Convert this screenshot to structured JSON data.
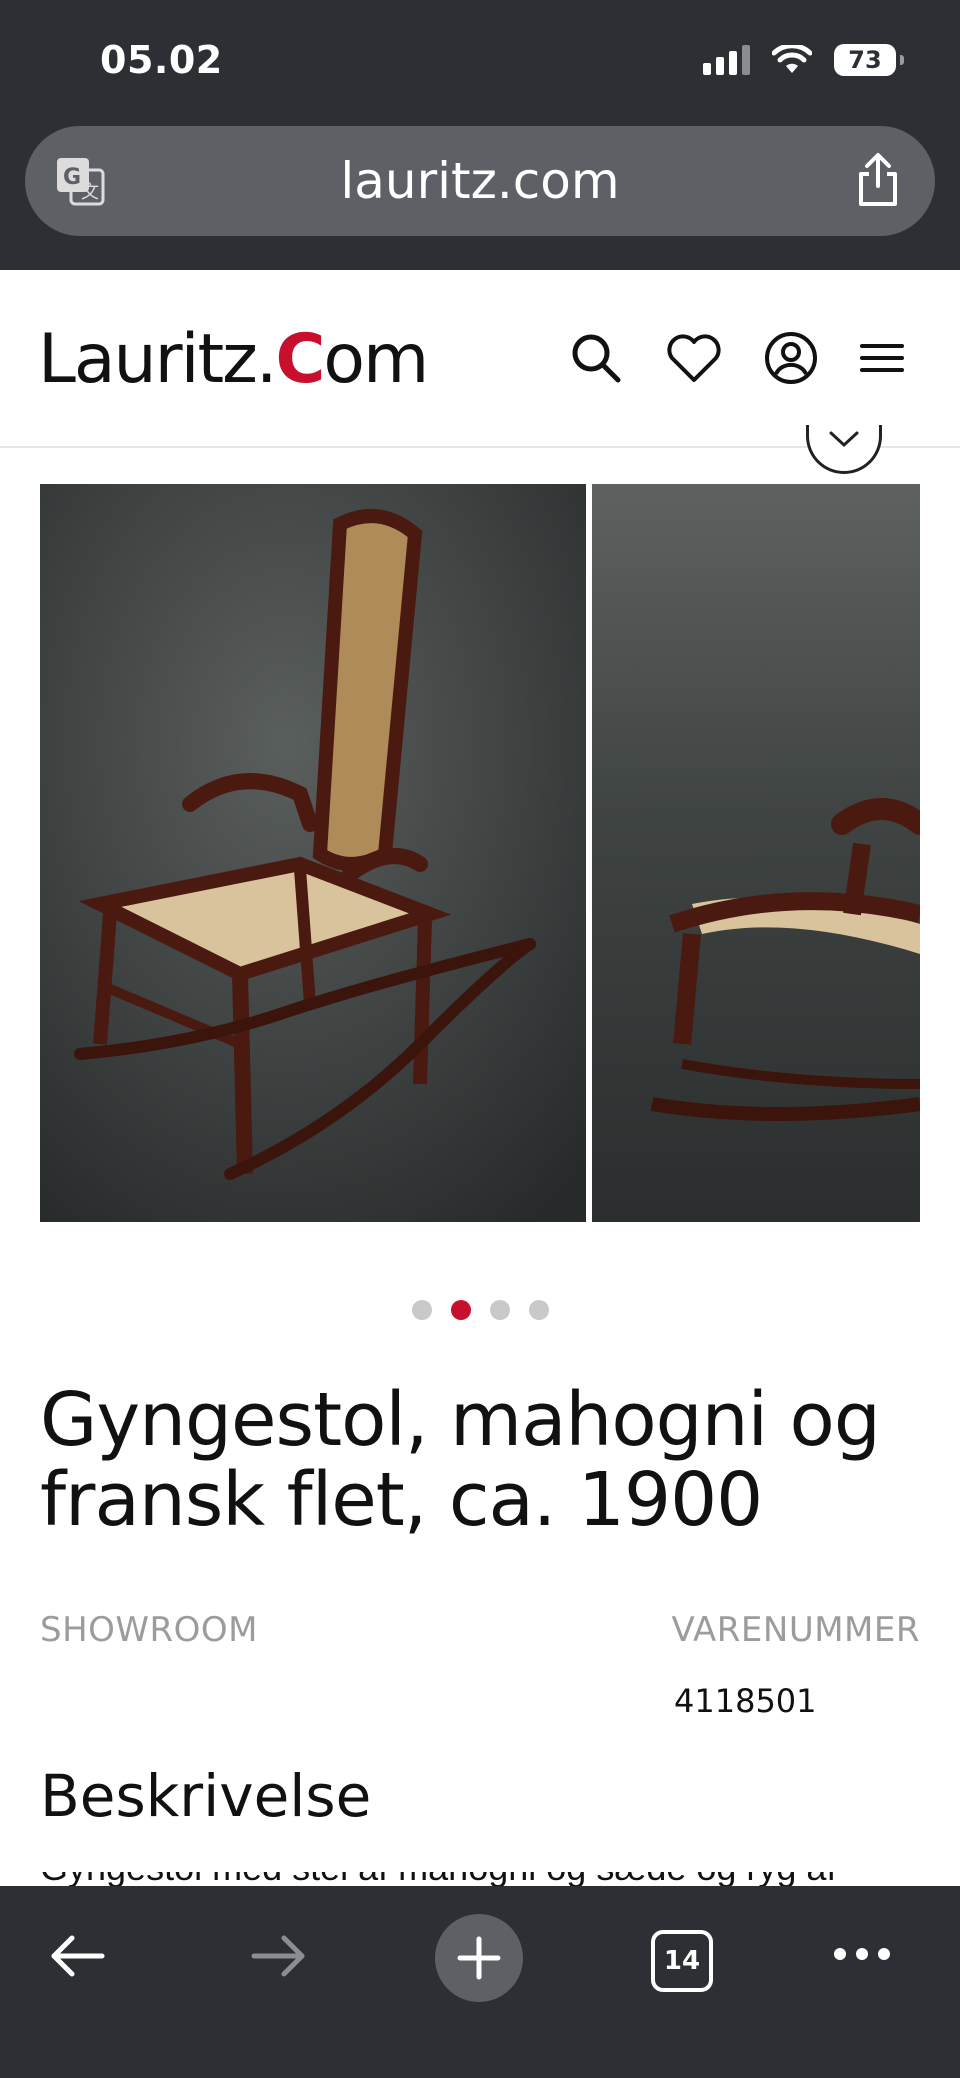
{
  "status_bar": {
    "time": "05.02",
    "battery": "73"
  },
  "address_bar": {
    "url": "lauritz.com"
  },
  "site": {
    "logo_part1": "Lauritz.",
    "logo_c": "C",
    "logo_part2": "om",
    "brand_color": "#c8102e"
  },
  "gallery": {
    "image_count": 4,
    "active_index": 1,
    "images": [
      "rocking-chair-front",
      "rocking-chair-side"
    ]
  },
  "product": {
    "title": "Gyngestol, mahogni og fransk flet, ca. 1900",
    "showroom_label": "SHOWROOM",
    "item_number_label": "VARENUMMER",
    "item_number": "4118501",
    "description_heading": "Beskrivelse",
    "description_peek": "Gyngestol med stel af mahogni og sæde og ryg af fransk flet"
  },
  "toolbar": {
    "tabs_count": "14"
  }
}
